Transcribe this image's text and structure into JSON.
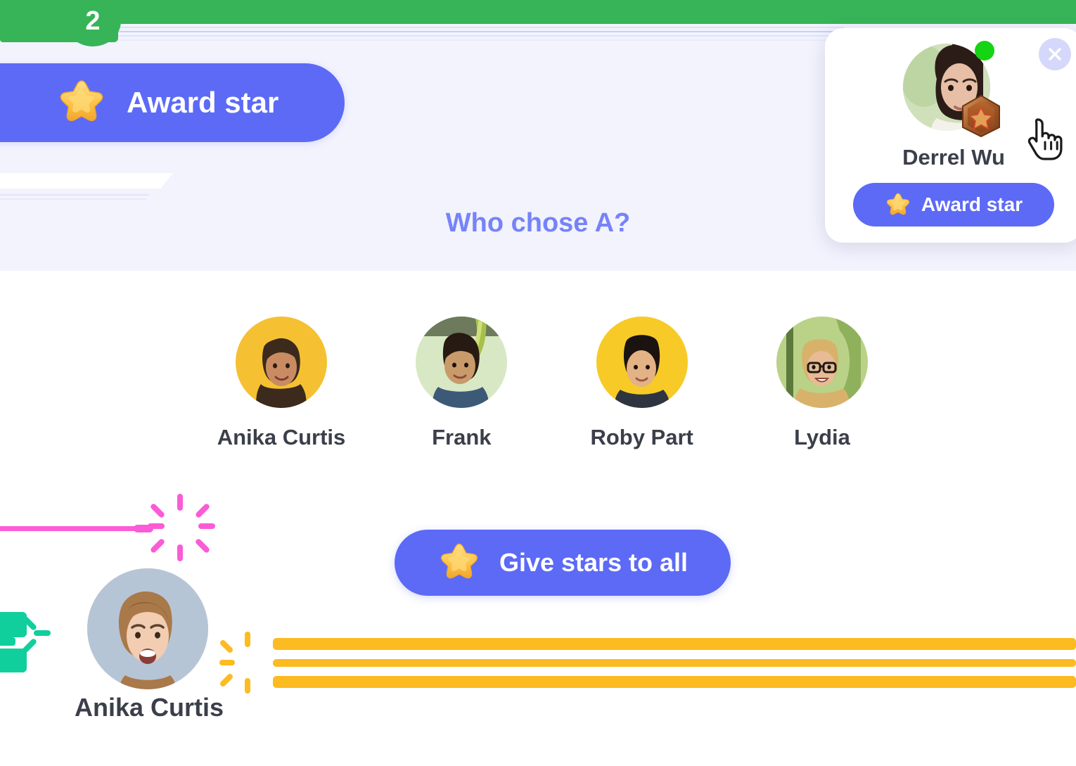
{
  "theme": {
    "accent_purple": "#5c6af6",
    "question_purple": "#7683f8",
    "panel_lavender": "#f2f3fd",
    "green": "#36b457",
    "online_green": "#14d414",
    "pink": "#fb5bd6",
    "teal": "#11cf9c",
    "yellow": "#fbbb21",
    "text_dark": "#3b3f4a"
  },
  "header": {
    "count_badge": "2",
    "award_star_label": "Award star",
    "star_icon": "star-icon"
  },
  "main": {
    "question": "Who chose A?",
    "students": [
      {
        "name": "Anika Curtis",
        "avatar": "avatar-anika-curtis"
      },
      {
        "name": "Frank",
        "avatar": "avatar-frank"
      },
      {
        "name": "Roby Part",
        "avatar": "avatar-roby-part"
      },
      {
        "name": "Lydia",
        "avatar": "avatar-lydia"
      }
    ],
    "give_all_label": "Give stars to all",
    "give_all_icon": "star-icon"
  },
  "highlight": {
    "name": "Anika Curtis",
    "avatar": "avatar-anika-curtis-large"
  },
  "popup": {
    "name": "Derrel Wu",
    "award_label": "Award star",
    "close_icon": "close-icon",
    "status_icon": "online-dot-icon",
    "rank_icon": "bronze-star-badge-icon",
    "star_icon": "star-icon",
    "cursor_icon": "pointer-hand-cursor-icon"
  }
}
